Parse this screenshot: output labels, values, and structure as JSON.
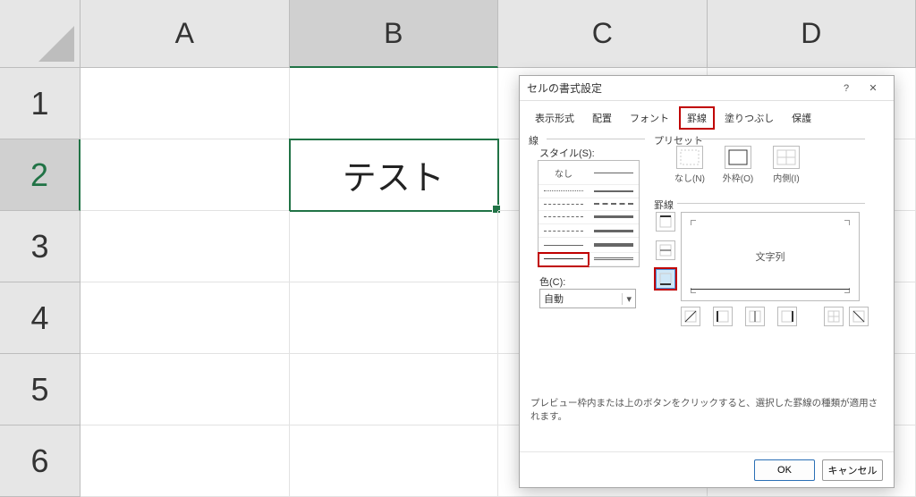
{
  "columns": [
    "A",
    "B",
    "C",
    "D"
  ],
  "rows": [
    "1",
    "2",
    "3",
    "4",
    "5",
    "6"
  ],
  "activeCol": 1,
  "activeRow": 1,
  "cellValue": "テスト",
  "dialog": {
    "title": "セルの書式設定",
    "help": "?",
    "close": "✕",
    "tabs": [
      "表示形式",
      "配置",
      "フォント",
      "罫線",
      "塗りつぶし",
      "保護"
    ],
    "activeTab": 3,
    "lineGroup": "線",
    "styleLabel": "スタイル(S):",
    "noneLabel": "なし",
    "colorLabel": "色(C):",
    "colorValue": "自動",
    "presetGroup": "プリセット",
    "presets": [
      {
        "label": "なし(N)"
      },
      {
        "label": "外枠(O)"
      },
      {
        "label": "内側(I)"
      }
    ],
    "borderGroup": "罫線",
    "previewText": "文字列",
    "hint": "プレビュー枠内または上のボタンをクリックすると、選択した罫線の種類が適用されます。",
    "ok": "OK",
    "cancel": "キャンセル"
  }
}
